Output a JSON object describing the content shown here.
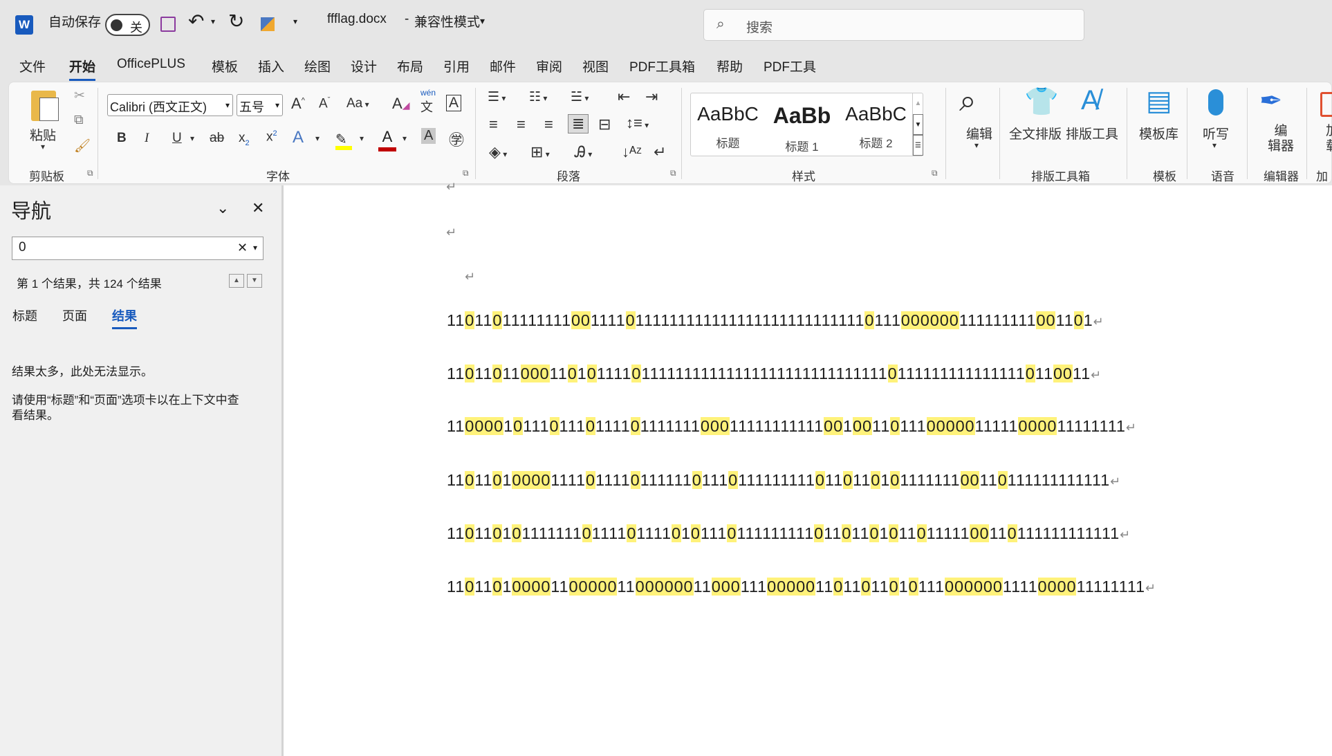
{
  "titlebar": {
    "app_icon": "word-icon",
    "autosave_label": "自动保存",
    "autosave_state": "关",
    "filename": "ffflag.docx",
    "separator": "-",
    "mode": "兼容性模式",
    "search_placeholder": "搜索"
  },
  "tabs": [
    "文件",
    "开始",
    "OfficePLUS",
    "模板",
    "插入",
    "绘图",
    "设计",
    "布局",
    "引用",
    "邮件",
    "审阅",
    "视图",
    "PDF工具箱",
    "帮助",
    "PDF工具"
  ],
  "active_tab": "开始",
  "ribbon": {
    "clipboard": {
      "paste": "粘贴",
      "label": "剪贴板"
    },
    "font": {
      "name": "Calibri (西文正文)",
      "size": "五号",
      "label": "字体",
      "wen": "wén",
      "wen_char": "文",
      "case": "Aa"
    },
    "paragraph": {
      "label": "段落"
    },
    "styles": {
      "items": [
        {
          "preview": "AaBbC",
          "name": "标题"
        },
        {
          "preview": "AaBb",
          "name": "标题 1"
        },
        {
          "preview": "AaBbC",
          "name": "标题 2"
        }
      ],
      "label": "样式"
    },
    "editing": {
      "label": "编辑"
    },
    "layout_tools": {
      "full": "全文排版",
      "tool": "排版工具",
      "label": "排版工具箱"
    },
    "template": {
      "lib": "模板库",
      "label": "模板"
    },
    "voice": {
      "dictate": "听写",
      "label": "语音"
    },
    "editor": {
      "name": "编辑器",
      "label": "编辑器",
      "name_line1": "编",
      "name_line2": "辑器"
    },
    "addins": {
      "label": "加载",
      "cut1": "加",
      "cut2": "载"
    }
  },
  "nav": {
    "title": "导航",
    "search_value": "0",
    "result_summary": "第 1 个结果，共 124 个结果",
    "tabs": [
      "标题",
      "页面",
      "结果"
    ],
    "active_tab": "结果",
    "msg1": "结果太多，此处无法显示。",
    "msg2a": "请使用“标题”和“页面”选项卡以在上下文中查",
    "msg2b": "看结果。"
  },
  "document": {
    "paragraph_mark": "↵",
    "highlight_color": "#fff27a",
    "lines": [
      "1101101111111100111101111111111111111111111111110111000000111111111001101",
      "110110110001101011110111111111111111111111111111110111111111111111011001 1",
      "11000010111011101111011111110001111111111100100110111000001111100001111111 1",
      "110110100001111011110111111011101111111110110110101111111001101111111111 11",
      "110110101111111011110111101011101111111110110110101101111100110111111111111",
      "110110100001100000110000001100011100000110110110101110000001111000011111111"
    ]
  }
}
